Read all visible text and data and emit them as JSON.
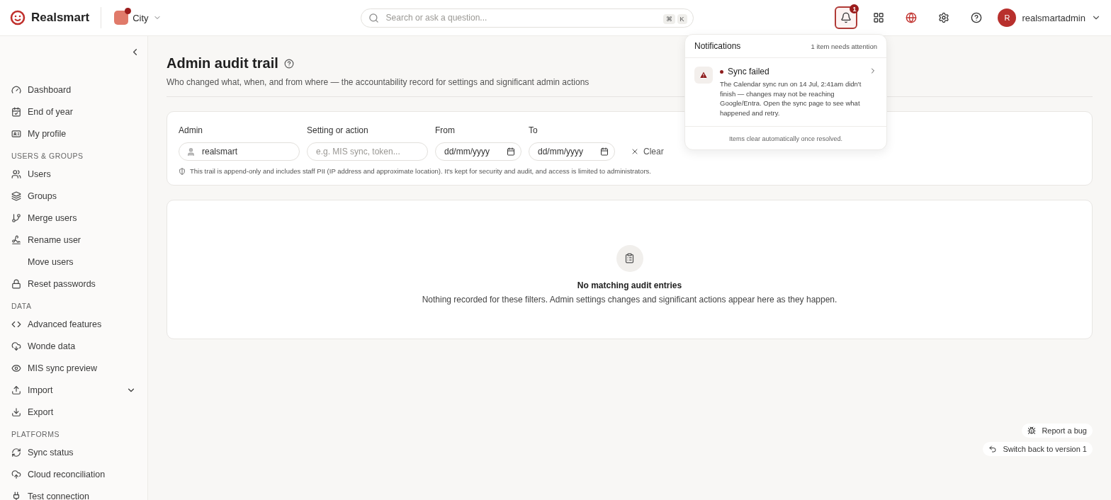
{
  "brand": {
    "name": "Realsmart"
  },
  "school": {
    "name": "City",
    "has_alert": true
  },
  "search": {
    "placeholder": "Search or ask a question...",
    "keys": [
      "⌘",
      "K"
    ]
  },
  "notifications_button": {
    "count": "1",
    "selected": true
  },
  "user": {
    "initial": "R",
    "name": "realsmartadmin"
  },
  "sidebar": {
    "sections": [
      {
        "items": [
          {
            "label": "Dashboard"
          },
          {
            "label": "End of year"
          },
          {
            "label": "My profile"
          }
        ]
      },
      {
        "heading": "USERS & GROUPS",
        "items": [
          {
            "label": "Users"
          },
          {
            "label": "Groups"
          },
          {
            "label": "Merge users"
          },
          {
            "label": "Rename user"
          },
          {
            "label": "Move users"
          },
          {
            "label": "Reset passwords"
          }
        ]
      },
      {
        "heading": "DATA",
        "items": [
          {
            "label": "Advanced features"
          },
          {
            "label": "Wonde data"
          },
          {
            "label": "MIS sync preview"
          },
          {
            "label": "Import",
            "expandable": true
          },
          {
            "label": "Export"
          }
        ]
      },
      {
        "heading": "PLATFORMS",
        "items": [
          {
            "label": "Sync status"
          },
          {
            "label": "Cloud reconciliation"
          },
          {
            "label": "Test connection"
          }
        ]
      }
    ]
  },
  "page": {
    "title": "Admin audit trail",
    "subtitle": "Who changed what, when, and from where — the accountability record for settings and significant admin actions"
  },
  "filters": [
    {
      "label": "Admin",
      "value": "realsmart",
      "kind": "user"
    },
    {
      "label": "Setting or action",
      "placeholder": "e.g. MIS sync, token...",
      "kind": "text"
    },
    {
      "label": "From",
      "placeholder": "dd/mm/yyyy",
      "kind": "date"
    },
    {
      "label": "To",
      "placeholder": "dd/mm/yyyy",
      "kind": "date"
    }
  ],
  "clear_button": "Clear",
  "privacy_note": "This trail is append-only and includes staff PII (IP address and approximate location). It's kept for security and audit, and access is limited to administrators.",
  "empty_state": {
    "title": "No matching audit entries",
    "message": "Nothing recorded for these filters. Admin settings changes and significant actions appear here as they happen."
  },
  "notifications": {
    "title": "Notifications",
    "summary": "1 item needs attention",
    "items": [
      {
        "title": "Sync failed",
        "unread": true,
        "body": "The Calendar sync run on 14 Jul, 2:41am didn't finish — changes may not be reaching Google/Entra. Open the sync page to see what happened and retry."
      }
    ],
    "footer": "Items clear automatically once resolved."
  },
  "footer_links": [
    "Report a bug",
    "Switch back to version 1"
  ]
}
